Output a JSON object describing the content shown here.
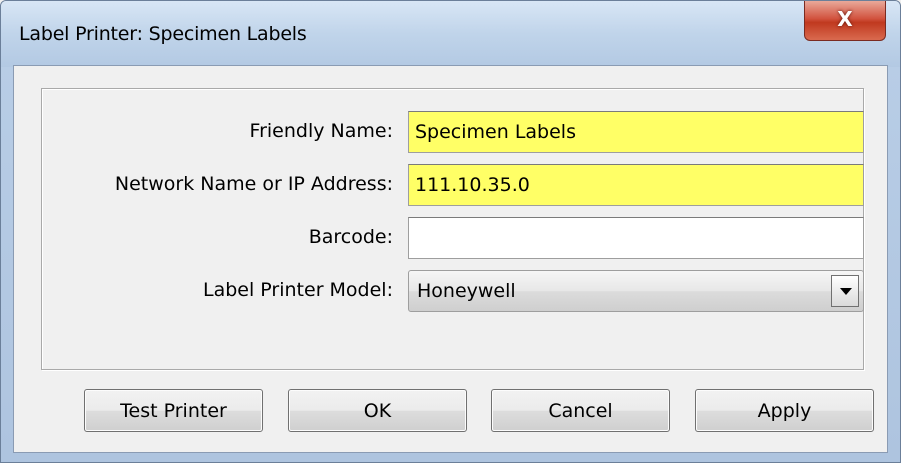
{
  "window": {
    "title": "Label Printer: Specimen Labels",
    "close_label": "X"
  },
  "form": {
    "friendly_name": {
      "label": "Friendly Name:",
      "value": "Specimen Labels"
    },
    "network_name": {
      "label": "Network Name or IP Address:",
      "value": "111.10.35.0"
    },
    "barcode": {
      "label": "Barcode:",
      "value": ""
    },
    "model": {
      "label": "Label Printer Model:",
      "selected": "Honeywell"
    }
  },
  "buttons": {
    "test_printer": "Test Printer",
    "ok": "OK",
    "cancel": "Cancel",
    "apply": "Apply"
  },
  "colors": {
    "required_field": "#ffff66",
    "close_button": "#c0391f"
  }
}
